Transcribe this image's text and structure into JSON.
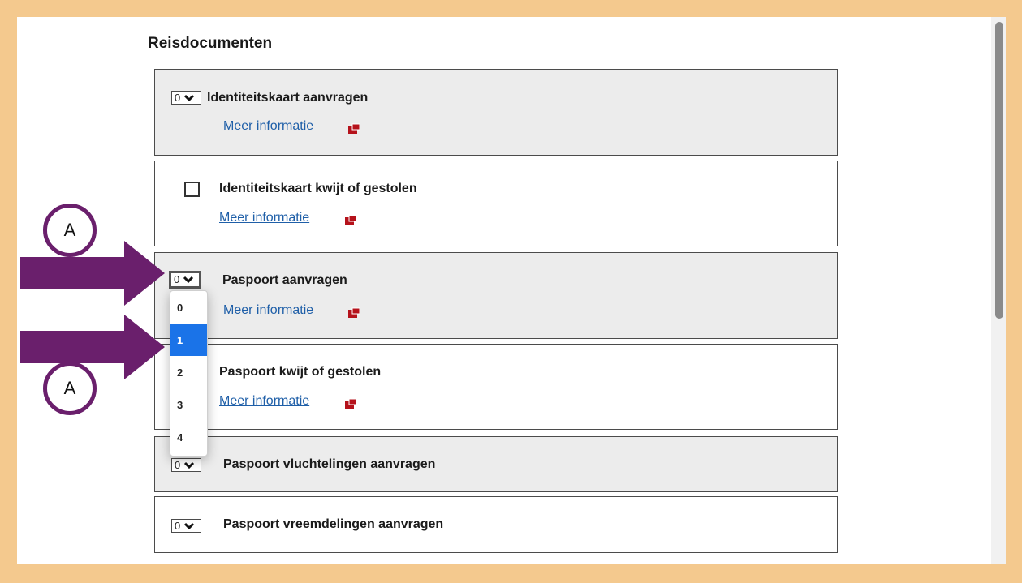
{
  "section": {
    "title": "Reisdocumenten"
  },
  "items": [
    {
      "title": "Identiteitskaart aanvragen",
      "link": "Meer informatie",
      "control": "select",
      "value": "0"
    },
    {
      "title": "Identiteitskaart kwijt of gestolen",
      "link": "Meer informatie",
      "control": "checkbox"
    },
    {
      "title": "Paspoort aanvragen",
      "link": "Meer informatie",
      "control": "select",
      "value": "0"
    },
    {
      "title": "Paspoort kwijt of gestolen",
      "link": "Meer informatie",
      "control": "checkbox"
    },
    {
      "title": "Paspoort vluchtelingen aanvragen",
      "control": "select",
      "value": "0"
    },
    {
      "title": "Paspoort vreemdelingen aanvragen",
      "control": "select",
      "value": "0"
    }
  ],
  "dropdown": {
    "options": [
      "0",
      "1",
      "2",
      "3",
      "4"
    ],
    "highlighted": "1"
  },
  "annotations": {
    "badge_top": "A",
    "badge_bottom": "A",
    "arrow_color": "#6a1f6c"
  },
  "colors": {
    "frame": "#f4c98e",
    "link": "#1f5fa8",
    "highlight": "#1a73e8",
    "icon": "#b5121b"
  }
}
